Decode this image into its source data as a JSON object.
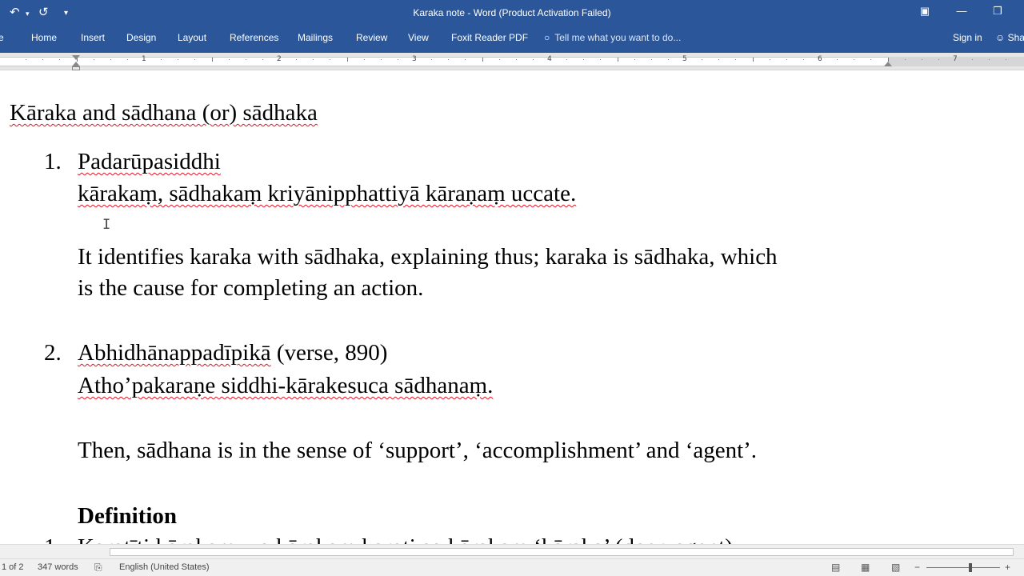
{
  "window": {
    "title": "Karaka note - Word (Product Activation Failed)",
    "accent": "#2b579a",
    "qat_icons": [
      "undo-icon",
      "redo-icon",
      "customize-qat-icon"
    ],
    "controls": [
      "ribbon-display-options-icon",
      "minimize-icon",
      "restore-icon"
    ]
  },
  "ribbon": {
    "tabs": [
      "Home",
      "Insert",
      "Design",
      "Layout",
      "References",
      "Mailings",
      "Review",
      "View",
      "Foxit Reader PDF"
    ],
    "tell_me": "Tell me what you want to do...",
    "sign_in": "Sign in",
    "share": "Sha"
  },
  "ruler": {
    "numbers": [
      "1",
      "2",
      "3",
      "4",
      "5",
      "6",
      "7"
    ]
  },
  "document": {
    "heading": "Kāraka and sādhana (or) sādhaka",
    "items": [
      {
        "number": "1.",
        "title": "Padarūpasiddhi",
        "quote": "kārakaṃ, sādhakaṃ kriyānipphattiyā kāraṇaṃ uccate.",
        "explanation_line1": "It identifies karaka with sādhaka, explaining thus; karaka is sādhaka, which",
        "explanation_line2": "is the cause for completing an action."
      },
      {
        "number": "2.",
        "title": "Abhidhānappadīpikā",
        "title_suffix": " (verse, 890)",
        "quote": "Atho’pakaraṇe siddhi-kārakesuca sādhanaṃ.",
        "explanation": "Then, sādhana is in the sense of ‘support’, ‘accomplishment’ and ‘agent’."
      }
    ],
    "definition_heading": "Definition",
    "partial_line_number": "1.",
    "partial_line": "Karotīti kārakaṃ, yo kārakaṃ karoti so kārakaṃ ‘kāraka’ (doer, agent)"
  },
  "status": {
    "page": "1 of 2",
    "words": "347 words",
    "language": "English (United States)"
  }
}
